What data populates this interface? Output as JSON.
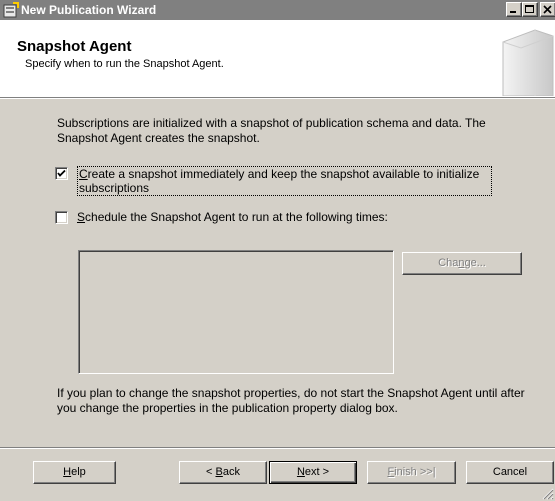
{
  "window": {
    "title": "New Publication Wizard",
    "icon": "wizard-app-icon",
    "controls": [
      "minimize-icon",
      "maximize-icon",
      "close-icon"
    ]
  },
  "header": {
    "title": "Snapshot Agent",
    "subtitle": "Specify when to run the Snapshot Agent."
  },
  "body": {
    "intro": "Subscriptions are initialized with a snapshot of publication schema and data. The Snapshot Agent creates the snapshot.",
    "option_immediate": {
      "mnemonic": "C",
      "rest": "reate a snapshot immediately and keep the snapshot available to initialize subscriptions",
      "checked": true
    },
    "option_schedule": {
      "mnemonic": "S",
      "rest": "chedule the Snapshot Agent to run at the following times:",
      "checked": false
    },
    "schedule_description": "",
    "change_button": {
      "pre": "Cha",
      "mnemonic": "n",
      "post": "ge...",
      "enabled": false
    },
    "note": "If you plan to change the snapshot properties, do not start the Snapshot Agent until after you change the properties in the publication property dialog box."
  },
  "buttons": {
    "help": {
      "mnemonic": "H",
      "rest": "elp"
    },
    "back": {
      "pre": "< ",
      "mnemonic": "B",
      "rest": "ack"
    },
    "next": {
      "mnemonic": "N",
      "rest": "ext >"
    },
    "finish": {
      "mnemonic": "F",
      "rest": "inish >>|",
      "enabled": false
    },
    "cancel": {
      "label": "Cancel"
    }
  },
  "colors": {
    "face": "#d4d0c8",
    "titlebar_inactive": "#808080",
    "header_bg": "#ffffff"
  }
}
